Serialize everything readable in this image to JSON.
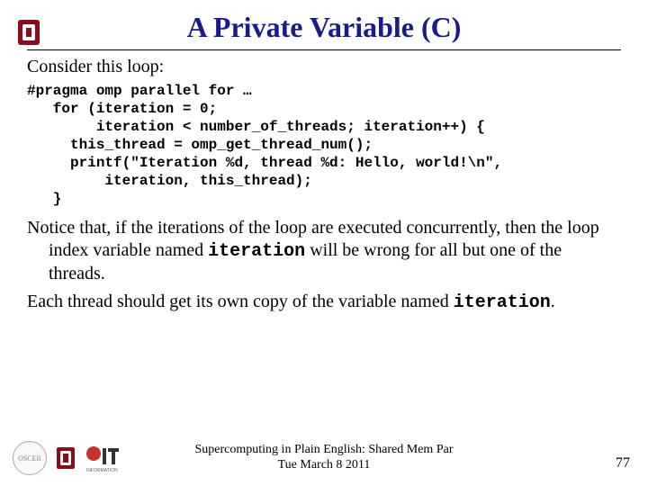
{
  "title": "A Private Variable (C)",
  "intro": "Consider this loop:",
  "code": "#pragma omp parallel for …\n   for (iteration = 0;\n        iteration < number_of_threads; iteration++) {\n     this_thread = omp_get_thread_num();\n     printf(\"Iteration %d, thread %d: Hello, world!\\n\",\n         iteration, this_thread);\n   }",
  "para1_pre": "Notice that, if the iterations of the loop are executed concurrently, then the loop index variable named ",
  "para1_code": "iteration",
  "para1_post": " will be wrong for all but one of the threads.",
  "para2_pre": "Each thread should get its own copy of the  variable named ",
  "para2_code": "iteration",
  "para2_post": ".",
  "footer_line1": "Supercomputing in Plain English: Shared Mem Par",
  "footer_line2": "Tue March 8  2011",
  "page_number": "77",
  "colors": {
    "title": "#1a1a8a",
    "ou_red": "#8a0d1e"
  }
}
